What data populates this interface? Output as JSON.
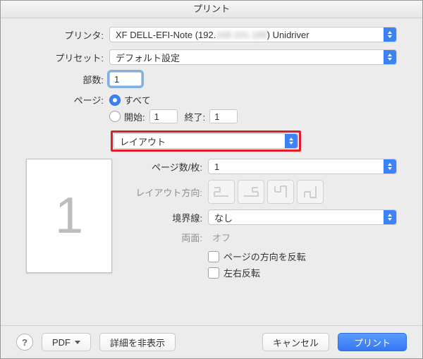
{
  "window": {
    "title": "プリント"
  },
  "labels": {
    "printer": "プリンタ:",
    "preset": "プリセット:",
    "copies": "部数:",
    "pages": "ページ:",
    "from": "開始:",
    "to": "終了:",
    "pages_per_sheet": "ページ数/枚:",
    "layout_direction": "レイアウト方向:",
    "border": "境界線:",
    "two_sided": "両面:"
  },
  "printer": {
    "selected_prefix": "XF DELL-EFI-Note (192.",
    "selected_blur": "168.101.188",
    "selected_suffix": ") Unidriver"
  },
  "preset": {
    "selected": "デフォルト設定"
  },
  "copies": {
    "value": "1"
  },
  "pages": {
    "all_label": "すべて",
    "all_selected": true,
    "from_value": "1",
    "to_value": "1"
  },
  "section_popup": {
    "selected": "レイアウト"
  },
  "preview": {
    "number": "1"
  },
  "layout": {
    "pages_per_sheet": "1",
    "border": "なし",
    "two_sided": "オフ",
    "reverse_page_orientation_label": "ページの方向を反転",
    "flip_horizontal_label": "左右反転",
    "reverse_page_orientation": false,
    "flip_horizontal": false
  },
  "bottom": {
    "pdf": "PDF",
    "hide_details": "詳細を非表示",
    "cancel": "キャンセル",
    "print": "プリント",
    "help": "?"
  }
}
